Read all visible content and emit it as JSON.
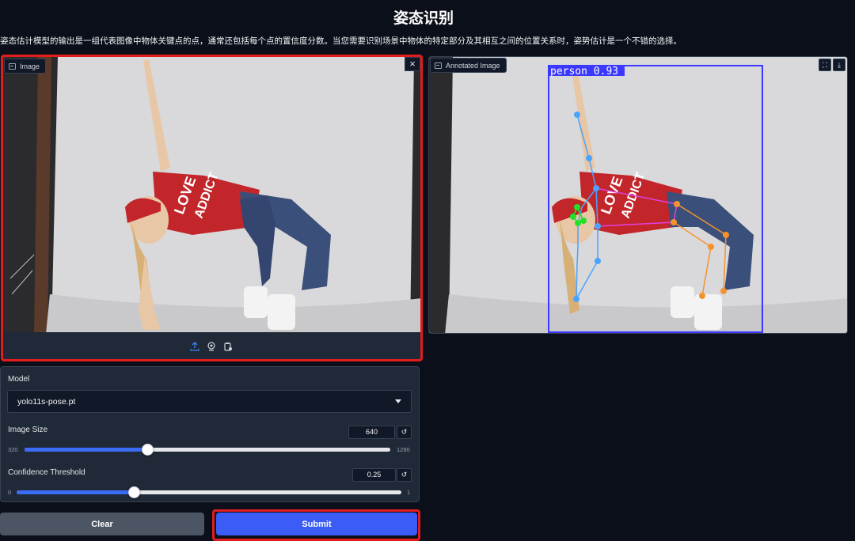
{
  "page": {
    "title": "姿态识别",
    "description": "姿态估计模型的输出是一组代表图像中物体关键点的点，通常还包括每个点的置信度分数。当您需要识别场景中物体的特定部分及其相互之间的位置关系时，姿势估计是一个不错的选择。"
  },
  "input_image": {
    "label": "Image",
    "close_icon": "close-icon",
    "toolbar_icons": [
      "upload-icon",
      "webcam-icon",
      "clipboard-icon"
    ]
  },
  "output_image": {
    "label": "Annotated Image",
    "toolbar_icons": [
      "fullscreen-icon",
      "download-icon"
    ],
    "detection_label": "person 0.93"
  },
  "settings": {
    "model_label": "Model",
    "model_value": "yolo11s-pose.pt",
    "image_size": {
      "label": "Image Size",
      "value": "640",
      "min": "320",
      "max": "1280",
      "level": 0.343
    },
    "confidence": {
      "label": "Confidence Threshold",
      "value": "0.25",
      "min": "0",
      "max": "1",
      "level": 0.25
    }
  },
  "buttons": {
    "clear": "Clear",
    "submit": "Submit"
  },
  "colors": {
    "accent": "#3b5cf5",
    "highlight": "#e11d1d",
    "background": "#0b0f19",
    "bbox": "#3b38ff"
  }
}
